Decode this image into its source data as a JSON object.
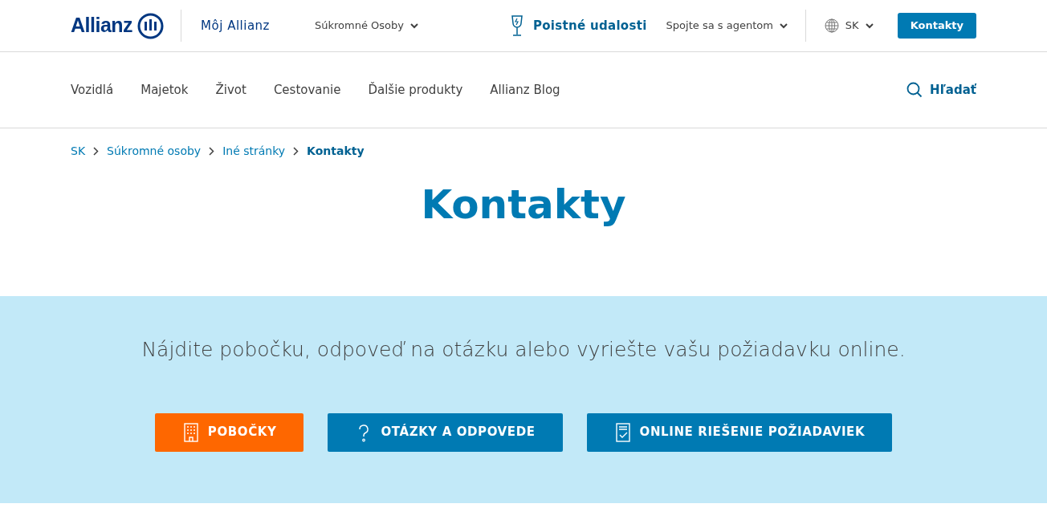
{
  "header": {
    "logo": "Allianz",
    "my_allianz": "Môj Allianz",
    "segment": "Súkromné Osoby",
    "claims": "Poistné udalosti",
    "agent": "Spojte sa s agentom",
    "language": "SK",
    "contact_button": "Kontakty"
  },
  "nav": {
    "items": [
      "Vozidlá",
      "Majetok",
      "Život",
      "Cestovanie",
      "Ďalšie produkty",
      "Allianz Blog"
    ],
    "search": "Hľadať"
  },
  "breadcrumb": [
    {
      "label": "SK",
      "selected": false
    },
    {
      "label": "Súkromné osoby",
      "selected": false
    },
    {
      "label": "Iné stránky",
      "selected": false
    },
    {
      "label": "Kontakty",
      "selected": true
    }
  ],
  "title": "Kontakty",
  "banner": {
    "text": "Nájdite pobočku, odpoveď na otázku alebo vyriešte vašu požiadavku online.",
    "buttons": [
      {
        "label": "POBOČKY",
        "kind": "building",
        "color": "#fe6700"
      },
      {
        "label": "OTÁZKY A ODPOVEDE",
        "kind": "question",
        "color": "#007ab3"
      },
      {
        "label": "ONLINE RIEŠENIE POŽIADAVIEK",
        "kind": "checklist",
        "color": "#007ab3"
      }
    ]
  }
}
